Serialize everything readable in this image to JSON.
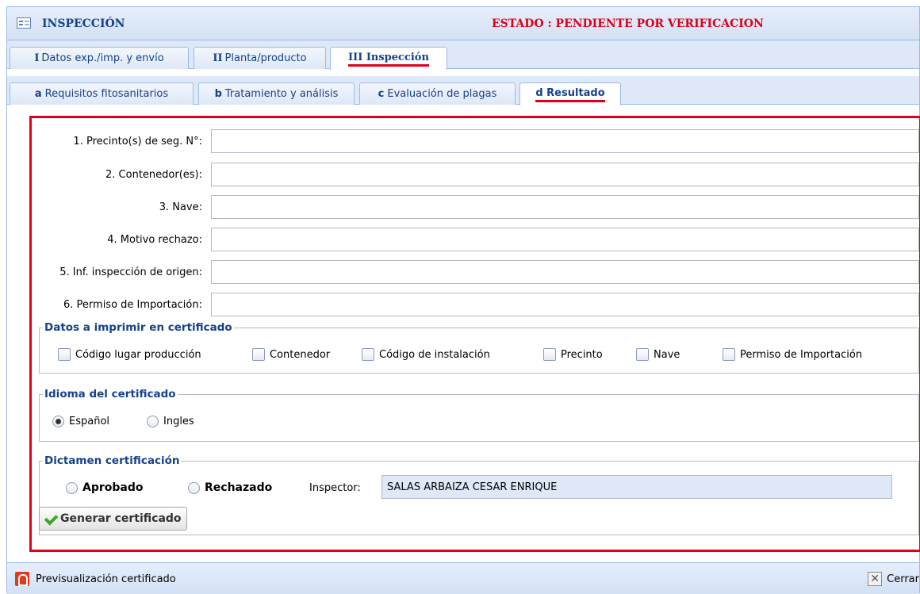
{
  "window": {
    "title": "INSPECCIÓN",
    "status": "ESTADO : PENDIENTE POR VERIFICACION"
  },
  "main_tabs": [
    {
      "prefix": "I",
      "label": "Datos exp./imp. y envío",
      "active": false
    },
    {
      "prefix": "II",
      "label": "Planta/producto",
      "active": false
    },
    {
      "prefix": "III",
      "label": "Inspección",
      "active": true
    }
  ],
  "sub_tabs": [
    {
      "prefix": "a",
      "label": "Requisitos fitosanitarios",
      "active": false
    },
    {
      "prefix": "b",
      "label": "Tratamiento y análisis",
      "active": false
    },
    {
      "prefix": "c",
      "label": "Evaluación de plagas",
      "active": false
    },
    {
      "prefix": "d",
      "label": "Resultado",
      "active": true
    }
  ],
  "form": {
    "fields": [
      {
        "label": "1. Precinto(s) de seg. N°:",
        "value": ""
      },
      {
        "label": "2. Contenedor(es):",
        "value": ""
      },
      {
        "label": "3. Nave:",
        "value": ""
      },
      {
        "label": "4. Motivo rechazo:",
        "value": ""
      },
      {
        "label": "5. Inf. inspección de origen:",
        "value": ""
      },
      {
        "label": "6. Permiso de Importación:",
        "value": ""
      }
    ]
  },
  "print_group": {
    "legend": "Datos a imprimir en certificado",
    "options": [
      {
        "label": "Código lugar producción",
        "checked": false
      },
      {
        "label": "Contenedor",
        "checked": false
      },
      {
        "label": "Código de instalación",
        "checked": false
      },
      {
        "label": "Precinto",
        "checked": false
      },
      {
        "label": "Nave",
        "checked": false
      },
      {
        "label": "Permiso de Importación",
        "checked": false
      }
    ]
  },
  "language_group": {
    "legend": "Idioma del certificado",
    "options": [
      {
        "label": "Español",
        "selected": true
      },
      {
        "label": "Ingles",
        "selected": false
      }
    ]
  },
  "verdict_group": {
    "legend": "Dictamen certificación",
    "options": [
      {
        "label": "Aprobado",
        "selected": false
      },
      {
        "label": "Rechazado",
        "selected": false
      }
    ],
    "inspector_label": "Inspector:",
    "inspector_value": "SALAS ARBAIZA CESAR ENRIQUE",
    "generate_button": "Generar certificado"
  },
  "footer": {
    "preview_label": "Previsualización certificado",
    "close_label": "Cerrar"
  },
  "colors": {
    "accent_red": "#e0001a",
    "header_blue": "#15428b",
    "panel_bg": "#dfe8f6"
  }
}
